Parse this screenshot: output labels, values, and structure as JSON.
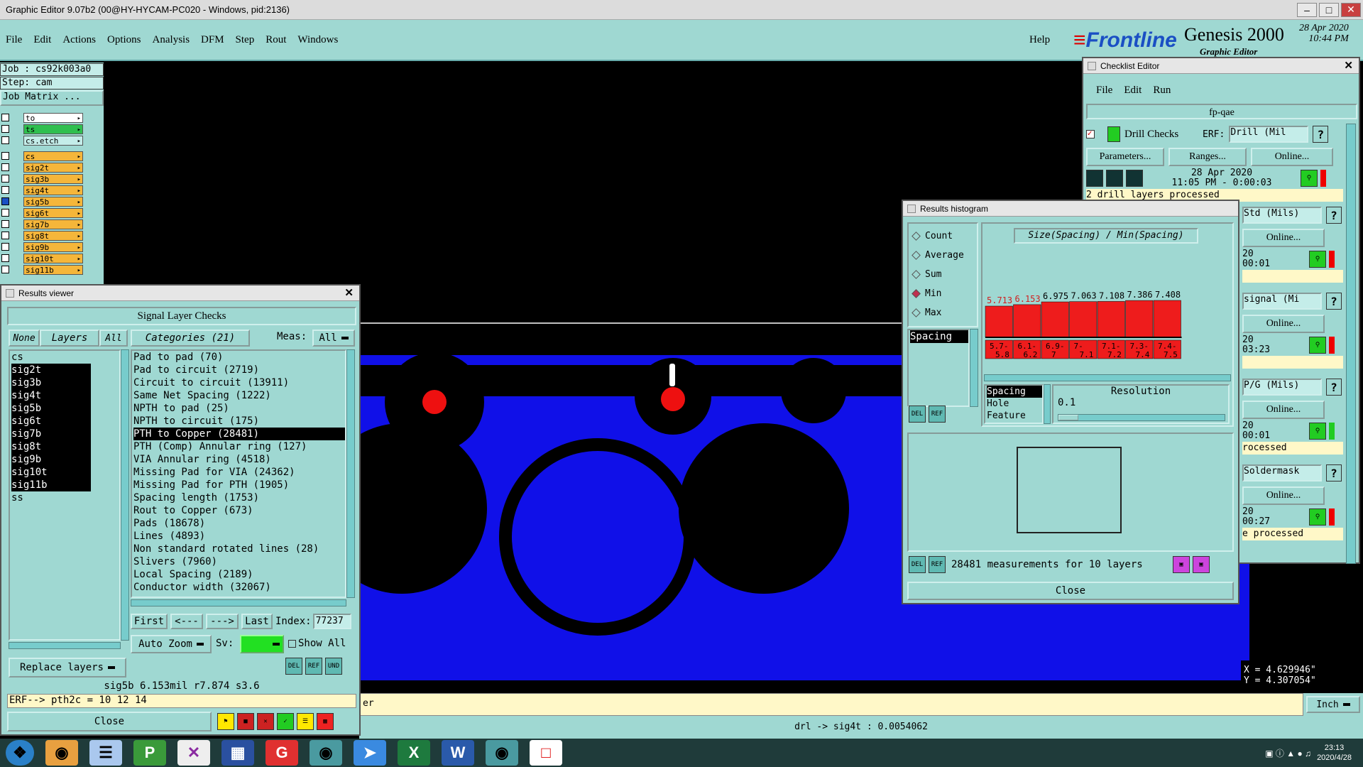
{
  "app": {
    "title": "Graphic Editor 9.07b2 (00@HY-HYCAM-PC020 - Windows, pid:2136)",
    "menu": [
      "File",
      "Edit",
      "Actions",
      "Options",
      "Analysis",
      "DFM",
      "Step",
      "Rout",
      "Windows"
    ],
    "help": "Help",
    "brand_logo": "Frontline",
    "brand_product": "Genesis 2000",
    "brand_sub": "Graphic Editor",
    "brand_date": "28 Apr 2020",
    "brand_time": "10:44 PM"
  },
  "left": {
    "job": "Job : cs92k003a0",
    "step": "Step: cam",
    "job_matrix": "Job Matrix ...",
    "layers_top": [
      {
        "name": "to",
        "color": "#ffffff"
      },
      {
        "name": "ts",
        "color": "#2fbf4f"
      },
      {
        "name": "cs.etch",
        "color": "#c4ede9"
      }
    ],
    "layers": [
      {
        "name": "cs",
        "color": "#f5b63a",
        "sel": false
      },
      {
        "name": "sig2t",
        "color": "#f5b63a",
        "sel": false
      },
      {
        "name": "sig3b",
        "color": "#f5b63a",
        "sel": false
      },
      {
        "name": "sig4t",
        "color": "#f5b63a",
        "sel": false
      },
      {
        "name": "sig5b",
        "color": "#f5b63a",
        "sel": true
      },
      {
        "name": "sig6t",
        "color": "#f5b63a",
        "sel": false
      },
      {
        "name": "sig7b",
        "color": "#f5b63a",
        "sel": false
      },
      {
        "name": "sig8t",
        "color": "#f5b63a",
        "sel": false
      },
      {
        "name": "sig9b",
        "color": "#f5b63a",
        "sel": false
      },
      {
        "name": "sig10t",
        "color": "#f5b63a",
        "sel": false
      },
      {
        "name": "sig11b",
        "color": "#f5b63a",
        "sel": false
      }
    ]
  },
  "results_viewer": {
    "title": "Results viewer",
    "heading": "Signal Layer Checks",
    "none": "None",
    "layers_label": "Layers",
    "all": "All",
    "categories_label": "Categories (21)",
    "meas_label": "Meas:",
    "meas_value": "All",
    "layer_list": [
      "cs",
      "sig2t",
      "sig3b",
      "sig4t",
      "sig5b",
      "sig6t",
      "sig7b",
      "sig8t",
      "sig9b",
      "sig10t",
      "sig11b",
      "ss"
    ],
    "layer_hl": [
      false,
      true,
      true,
      true,
      true,
      true,
      true,
      true,
      true,
      true,
      true,
      false
    ],
    "categories": [
      "Pad to pad (70)",
      "Pad to circuit (2719)",
      "Circuit to circuit (13911)",
      "Same Net Spacing (1222)",
      "NPTH to pad (25)",
      "NPTH to circuit (175)",
      "PTH to Copper (28481)",
      "PTH (Comp) Annular ring (127)",
      "VIA Annular ring (4518)",
      "Missing Pad for VIA (24362)",
      "Missing Pad for PTH (1905)",
      "Spacing length (1753)",
      "Rout to Copper (673)",
      "Pads (18678)",
      "Lines (4893)",
      "Non standard rotated lines (28)",
      "Slivers (7960)",
      "Local Spacing (2189)",
      "Conductor width (32067)"
    ],
    "selected_category_index": 6,
    "first": "First",
    "prev": "<---",
    "next": "--->",
    "last": "Last",
    "index_label": "Index:",
    "index_value": "77237",
    "auto_zoom": "Auto Zoom",
    "sv_label": "Sv:",
    "show_all": "Show All",
    "replace_layers": "Replace layers",
    "measurement": "sig5b   6.153mil   r7.874   s3.6",
    "erf": "ERF--> pth2c = 10 12 14",
    "close": "Close"
  },
  "histogram": {
    "title": "Results histogram",
    "modes": [
      "Count",
      "Average",
      "Sum",
      "Min",
      "Max"
    ],
    "selected_mode": "Min",
    "chart_title": "Size(Spacing) / Min(Spacing)",
    "list_top": [
      "Spacing"
    ],
    "list_bottom": [
      "Spacing",
      "Hole",
      "Feature"
    ],
    "resolution_label": "Resolution",
    "resolution_value": "0.1",
    "measurements": "28481 measurements for 10 layers",
    "close": "Close"
  },
  "chart_data": {
    "type": "bar",
    "title": "Size(Spacing) / Min(Spacing)",
    "categories": [
      "5.7-5.8",
      "6.1-6.2",
      "6.9-7",
      "7-7.1",
      "7.1-7.2",
      "7.3-7.4",
      "7.4-7.5"
    ],
    "category_lines": [
      [
        "5.7-",
        "5.8"
      ],
      [
        "6.1-",
        "6.2"
      ],
      [
        "6.9-",
        "7"
      ],
      [
        "7-",
        "7.1"
      ],
      [
        "7.1-",
        "7.2"
      ],
      [
        "7.3-",
        "7.4"
      ],
      [
        "7.4-",
        "7.5"
      ]
    ],
    "values": [
      5.713,
      6.153,
      6.975,
      7.063,
      7.108,
      7.386,
      7.408
    ],
    "value_labels": [
      "5.713",
      "6.153",
      "6.975",
      "7.063",
      "7.108",
      "7.386",
      "7.408"
    ],
    "highlight_label_color": "#d02020",
    "bar_color": "#ee1c1c"
  },
  "checklist": {
    "title": "Checklist Editor",
    "menu": [
      "File",
      "Edit",
      "Run"
    ],
    "name": "fp-qae",
    "drill_checks": "Drill Checks",
    "erf_label": "ERF:",
    "erf_value": "Drill (Mil",
    "parameters": "Parameters...",
    "ranges": "Ranges...",
    "online": "Online...",
    "drill_date": "28 Apr 2020",
    "drill_time": "11:05 PM - 0:00:03",
    "drill_status": "2 drill layers processed",
    "rows": [
      {
        "erf": "Std (Mils)",
        "date": "20",
        "time": "00:01",
        "status": ""
      },
      {
        "erf": "signal (Mi",
        "date": "20",
        "time": "03:23",
        "status": ""
      },
      {
        "erf": "P/G (Mils)",
        "date": "20",
        "time": "00:01",
        "status": "rocessed"
      },
      {
        "erf": "Soldermask",
        "date": "20",
        "time": "00:27",
        "status": "e processed"
      }
    ]
  },
  "status": {
    "command": "er",
    "measure": "drl -> sig4t : 0.0054062",
    "x": "X = 4.629946\"",
    "y": "Y = 4.307054\"",
    "unit": "Inch"
  },
  "taskbar": {
    "time": "23:13",
    "date": "2020/4/28"
  }
}
